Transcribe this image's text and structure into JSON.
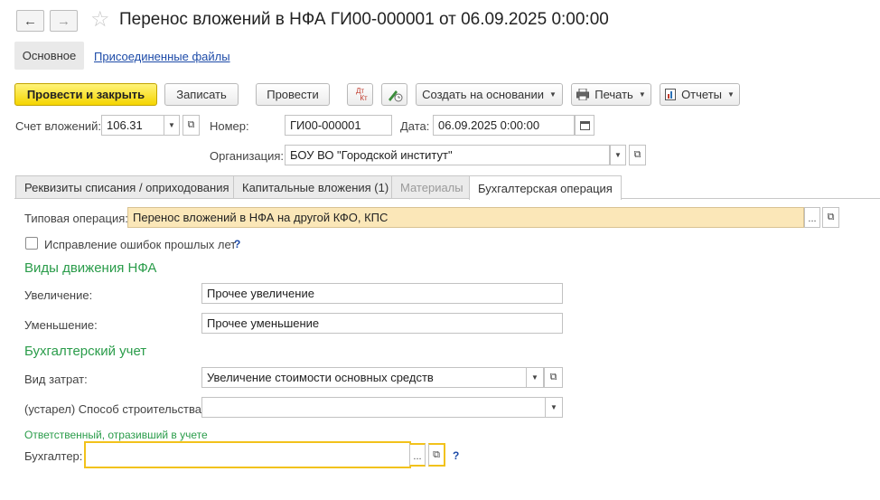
{
  "header": {
    "back_label": "←",
    "forward_label": "→",
    "favorite_glyph": "☆",
    "title": "Перенос вложений в НФА ГИ00-000001 от 06.09.2025 0:00:00"
  },
  "nav": {
    "main": "Основное",
    "files": "Присоединенные файлы"
  },
  "toolbar": {
    "post_close": "Провести и закрыть",
    "save": "Записать",
    "post": "Провести",
    "dtkt_top": "Дт",
    "dtkt_bottom": "Кт",
    "create_based": "Создать на основании",
    "print": "Печать",
    "reports": "Отчеты"
  },
  "form": {
    "account_label": "Счет вложений:",
    "account_value": "106.31",
    "number_label": "Номер:",
    "number_value": "ГИ00-000001",
    "date_label": "Дата:",
    "date_value": "06.09.2025  0:00:00",
    "org_label": "Организация:",
    "org_value": "БОУ ВО \"Городской институт\""
  },
  "tabs": [
    {
      "label": "Реквизиты списания / оприходования"
    },
    {
      "label": "Капитальные вложения (1)"
    },
    {
      "label": "Материалы"
    },
    {
      "label": "Бухгалтерская операция"
    }
  ],
  "operation": {
    "typical_label": "Типовая операция:",
    "typical_value": "Перенос вложений в НФА на другой КФО, КПС",
    "fix_errors_label": "Исправление ошибок прошлых лет",
    "help": "?",
    "movement_section": "Виды движения НФА",
    "increase_label": "Увеличение:",
    "increase_value": "Прочее увеличение",
    "decrease_label": "Уменьшение:",
    "decrease_value": "Прочее уменьшение",
    "accounting_section": "Бухгалтерский учет",
    "cost_type_label": "Вид затрат:",
    "cost_type_value": "Увеличение стоимости основных средств",
    "construction_label": "(устарел) Способ строительства:",
    "construction_value": "",
    "responsible_section": "Ответственный, отразивший в учете",
    "accountant_label": "Бухгалтер:",
    "accountant_value": ""
  },
  "colors": {
    "accent_green": "#2a9c4a",
    "primary_button": "#f5d500",
    "link": "#1d4ba8"
  }
}
